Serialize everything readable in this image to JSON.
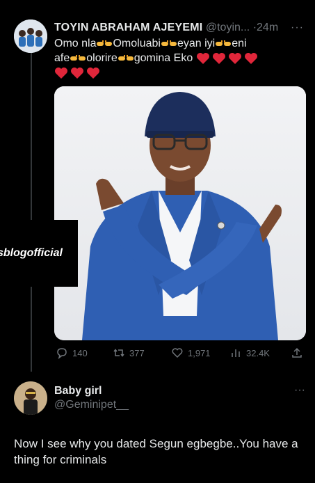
{
  "post": {
    "display_name": "TOYIN ABRAHAM AJEYEMI",
    "handle": "@toyin...",
    "time": "·24m",
    "more": "···",
    "text_parts": [
      "Omo nla",
      "Omoluabi",
      "eyan iyi",
      "eni",
      "afe",
      "olorire",
      "gomina Eko"
    ],
    "hand_icon": "pointing-hands-emoji",
    "heart_icon": "red-heart-emoji",
    "heart_color": "#e0263a",
    "heart_count": 7
  },
  "watermark": {
    "text": "sblogofficial"
  },
  "actions": {
    "replies": "140",
    "reposts": "377",
    "likes": "1,971",
    "views": "32.4K"
  },
  "reply": {
    "display_name": "Baby girl",
    "handle": "@Geminipet__",
    "more": "···",
    "text": "Now I see why you dated Segun egbegbe..You have a thing for criminals"
  },
  "colors": {
    "background": "#000000",
    "text": "#e7e9ea",
    "muted": "#71767b",
    "suit_blue": "#2f5fb3",
    "cap_navy": "#1c2e5c"
  }
}
